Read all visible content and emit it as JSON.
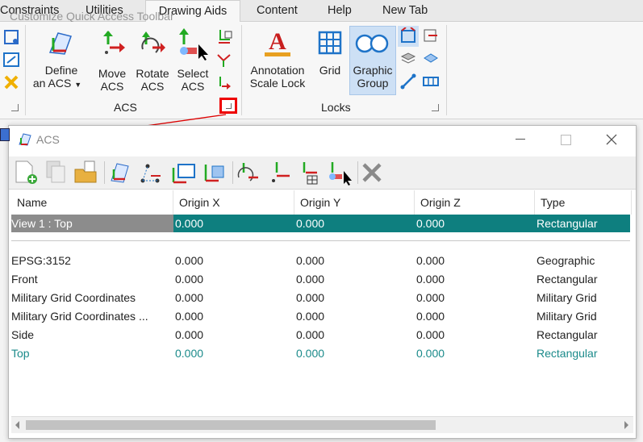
{
  "ribbon": {
    "tabs": [
      "Constraints",
      "Utilities",
      "Drawing Aids",
      "Content",
      "Help",
      "New Tab"
    ],
    "active_tab": "Drawing Aids",
    "qat_tooltip": "Customize Quick Access Toolbar",
    "acs_group": {
      "label": "ACS",
      "define_line1": "Define",
      "define_line2": "an ACS",
      "move_line1": "Move",
      "move_line2": "ACS",
      "rotate_line1": "Rotate",
      "rotate_line2": "ACS",
      "select_line1": "Select",
      "select_line2": "ACS"
    },
    "locks_group": {
      "label": "Locks",
      "annotation_line1": "Annotation",
      "annotation_line2": "Scale Lock",
      "grid": "Grid",
      "graphic_line1": "Graphic",
      "graphic_line2": "Group"
    }
  },
  "dialog": {
    "title": "ACS",
    "columns": [
      "Name",
      "Origin X",
      "Origin Y",
      "Origin Z",
      "Type"
    ],
    "active_row": {
      "name": "View 1 : Top",
      "x": "0.000",
      "y": "0.000",
      "z": "0.000",
      "type": "Rectangular"
    },
    "rows": [
      {
        "name": "EPSG:3152",
        "x": "0.000",
        "y": "0.000",
        "z": "0.000",
        "type": "Geographic"
      },
      {
        "name": "Front",
        "x": "0.000",
        "y": "0.000",
        "z": "0.000",
        "type": "Rectangular"
      },
      {
        "name": "Military Grid Coordinates",
        "x": "0.000",
        "y": "0.000",
        "z": "0.000",
        "type": "Military Grid"
      },
      {
        "name": "Military Grid Coordinates ...",
        "x": "0.000",
        "y": "0.000",
        "z": "0.000",
        "type": "Military Grid"
      },
      {
        "name": "Side",
        "x": "0.000",
        "y": "0.000",
        "z": "0.000",
        "type": "Rectangular"
      },
      {
        "name": "Top",
        "x": "0.000",
        "y": "0.000",
        "z": "0.000",
        "type": "Rectangular"
      }
    ]
  },
  "colors": {
    "active_row": "#0e7f7f",
    "active_name_cell": "#8c8c8c",
    "highlight_text": "#1a8a8a",
    "callout": "#dd0000"
  }
}
